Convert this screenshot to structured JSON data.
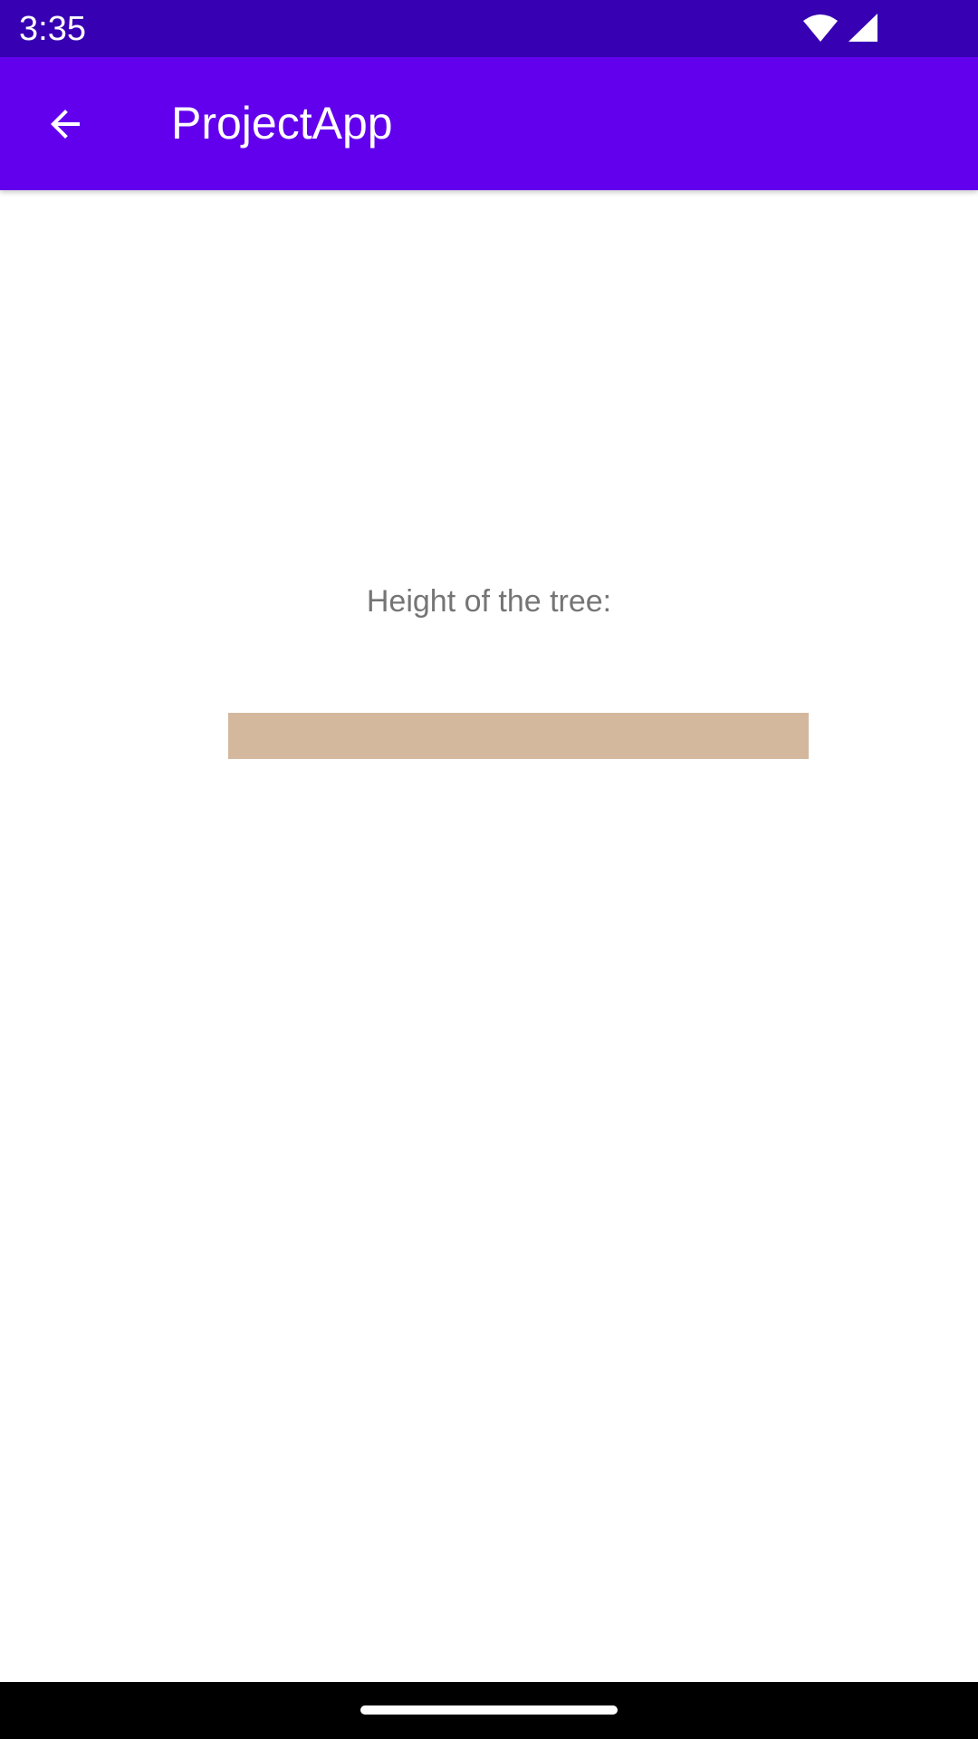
{
  "status_bar": {
    "time": "3:35",
    "icons": [
      "wifi-icon",
      "signal-icon"
    ],
    "background": "#3700b3"
  },
  "app_bar": {
    "title": "ProjectApp",
    "back_icon": "arrow-back-icon",
    "background": "#6200ee"
  },
  "form": {
    "height_label": "Height of the tree:",
    "height_value": "",
    "input_background": "#d4b89d"
  },
  "nav_bar": {
    "background": "#000000"
  }
}
